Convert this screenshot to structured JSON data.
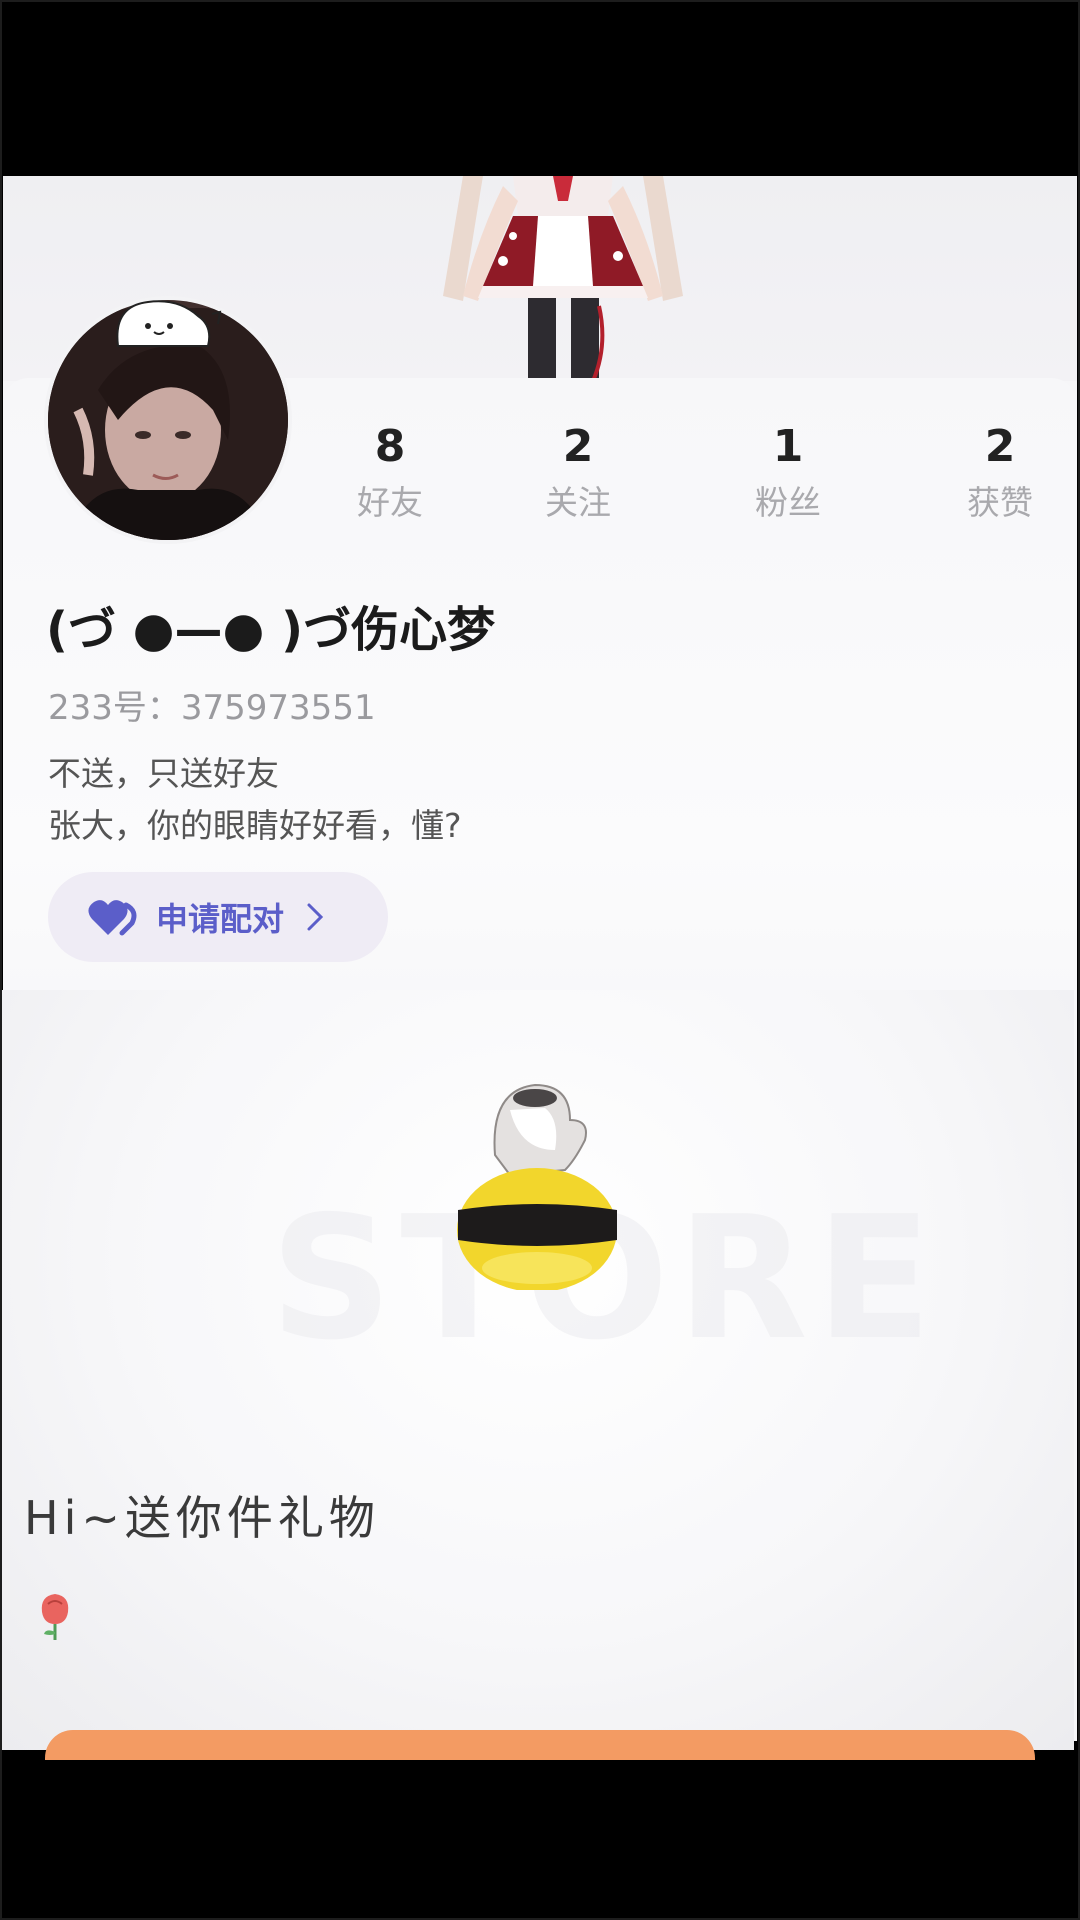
{
  "stats": [
    {
      "value": "8",
      "label": "好友"
    },
    {
      "value": "2",
      "label": "关注"
    },
    {
      "value": "1",
      "label": "粉丝"
    },
    {
      "value": "2",
      "label": "获赞"
    }
  ],
  "profile": {
    "nickname": "(づ ●—● )づ伤心梦",
    "uid": "233号：375973551",
    "bio_line1": "不送，只送好友",
    "bio_line2": "张大，你的眼睛好好看，懂?"
  },
  "pair_button": {
    "label": "申请配对",
    "icon": "heart-icon",
    "accent": "#5b5ec9"
  },
  "gift": {
    "watermark": "STORE",
    "message": "Hi~送你件礼物",
    "icon": "rose-icon"
  },
  "colors": {
    "accent_orange": "#f39b63",
    "stat_label": "#a9a9ad"
  }
}
